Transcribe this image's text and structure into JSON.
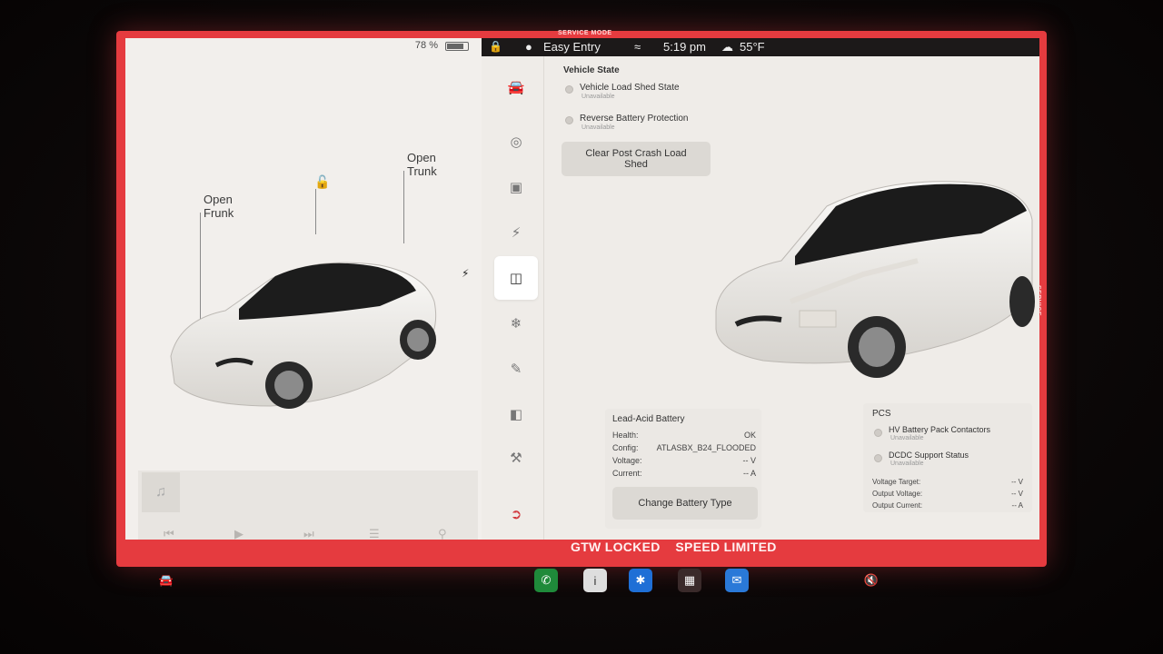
{
  "service_mode": {
    "label": "SERVICE MODE"
  },
  "left_panel": {
    "battery_percent": "78 %",
    "open_frunk": {
      "line1": "Open",
      "line2": "Frunk"
    },
    "open_trunk": {
      "line1": "Open",
      "line2": "Trunk"
    }
  },
  "topbar": {
    "profile": "Easy Entry",
    "time": "5:19 pm",
    "temperature": "55°F"
  },
  "vehicle_state": {
    "title": "Vehicle State",
    "rows": [
      {
        "label": "Vehicle Load Shed State",
        "status": "Unavailable"
      },
      {
        "label": "Reverse Battery Protection",
        "status": "Unavailable"
      }
    ],
    "button": {
      "line1": "Clear Post Crash Load",
      "line2": "Shed"
    }
  },
  "lead_acid": {
    "title": "Lead-Acid Battery",
    "rows": [
      {
        "key": "Health:",
        "value": "OK"
      },
      {
        "key": "Config:",
        "value": "ATLASBX_B24_FLOODED"
      },
      {
        "key": "Voltage:",
        "value": "-- V"
      },
      {
        "key": "Current:",
        "value": "-- A"
      }
    ],
    "button": "Change Battery Type"
  },
  "pcs": {
    "title": "PCS",
    "rows": [
      {
        "label": "HV Battery Pack Contactors",
        "status": "Unavailable"
      },
      {
        "label": "DCDC Support Status",
        "status": "Unavailable"
      }
    ],
    "kv": [
      {
        "key": "Voltage Target:",
        "value": "-- V"
      },
      {
        "key": "Output Voltage:",
        "value": "-- V"
      },
      {
        "key": "Output Current:",
        "value": "-- A"
      }
    ]
  },
  "alert_bar": {
    "text": "GTW LOCKED    SPEED LIMITED"
  },
  "colors": {
    "service_red": "#e53b3f",
    "panel_bg": "#efece8"
  }
}
